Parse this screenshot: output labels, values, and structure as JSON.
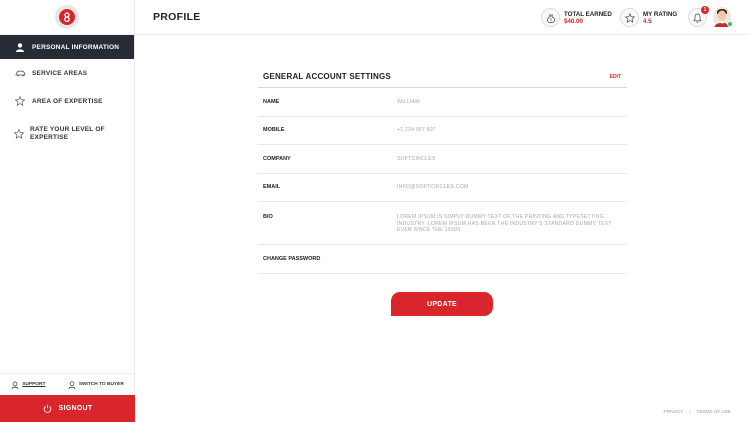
{
  "sidebar": {
    "items": [
      {
        "label": "PERSONAL INFORMATION",
        "icon": "user-icon"
      },
      {
        "label": "SERVICE AREAS",
        "icon": "car-icon"
      },
      {
        "label": "AREA OF EXPERTISE",
        "icon": "star-icon"
      },
      {
        "label": "RATE YOUR LEVEL OF EXPERTISE",
        "icon": "star-icon"
      }
    ],
    "footer": {
      "support_label": "SUPPORT",
      "switch_label": "SWITCH TO BUYER"
    },
    "signout_label": "SIGNOUT"
  },
  "header": {
    "title": "PROFILE",
    "earned_label": "TOTAL EARNED",
    "earned_value": "$40.00",
    "rating_label": "MY RATING",
    "rating_value": "4.5",
    "notification_count": "1"
  },
  "card": {
    "title": "GENERAL ACCOUNT SETTINGS",
    "edit_label": "EDIT",
    "fields": [
      {
        "key": "NAME",
        "value": "WILLIAM"
      },
      {
        "key": "MOBILE",
        "value": "+1 234 567 897"
      },
      {
        "key": "COMPANY",
        "value": "SOFTCIRCLES"
      },
      {
        "key": "EMAIL",
        "value": "INFO@SOFTCIRCLES.COM"
      },
      {
        "key": "BIO",
        "value": "LOREM IPSUM IS SIMPLY DUMMY TEXT OF THE PRINTING AND TYPESETTING INDUSTRY. LOREM IPSUM HAS BEEN THE INDUSTRY'S STANDARD DUMMY TEXT EVER SINCE THE 1500S."
      },
      {
        "key": "CHANGE PASSWORD",
        "value": ""
      }
    ]
  },
  "update_label": "UPDATE",
  "bottom_links": {
    "privacy": "PRIVACY",
    "separator": "|",
    "terms": "TERMS OF USE"
  },
  "colors": {
    "accent": "#d9262c",
    "sidebar_active": "#262c33"
  }
}
